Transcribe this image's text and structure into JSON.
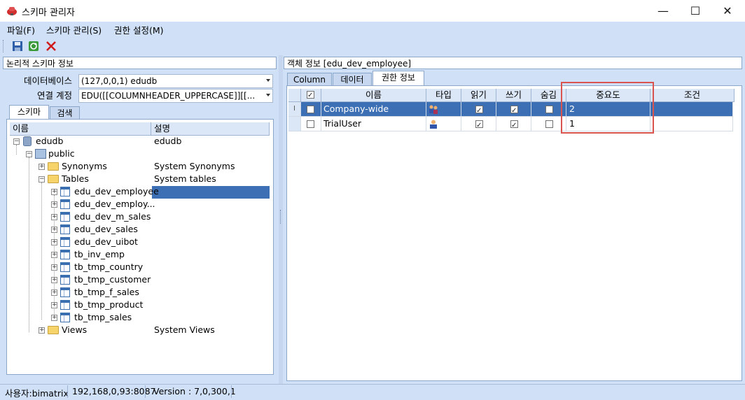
{
  "window": {
    "title": "스키마 관리자",
    "minimize": "—",
    "maximize": "☐",
    "close": "✕"
  },
  "menu": [
    "파일(F)",
    "스키마 관리(S)",
    "권한 설정(M)"
  ],
  "toolbar": {
    "icons": [
      "save-icon",
      "refresh-icon",
      "delete-icon"
    ]
  },
  "left": {
    "header": "논리적 스키마 정보",
    "db_label": "데이터베이스",
    "db_value": "(127,0,0,1) edudb",
    "account_label": "연결 계정",
    "account_value": "EDU([[COLUMNHEADER_UPPERCASE]][[...",
    "tabs": [
      "스키마",
      "검색"
    ],
    "columns": [
      "이름",
      "설명"
    ],
    "tree": [
      {
        "name": "edudb",
        "desc": "edudb"
      },
      {
        "name": "public",
        "desc": ""
      },
      {
        "name": "Synonyms",
        "desc": "System Synonyms"
      },
      {
        "name": "Tables",
        "desc": "System tables"
      },
      {
        "name": "edu_dev_employee",
        "desc": ""
      },
      {
        "name": "edu_dev_employ...",
        "desc": ""
      },
      {
        "name": "edu_dev_m_sales",
        "desc": ""
      },
      {
        "name": "edu_dev_sales",
        "desc": ""
      },
      {
        "name": "edu_dev_uibot",
        "desc": ""
      },
      {
        "name": "tb_inv_emp",
        "desc": ""
      },
      {
        "name": "tb_tmp_country",
        "desc": ""
      },
      {
        "name": "tb_tmp_customer",
        "desc": ""
      },
      {
        "name": "tb_tmp_f_sales",
        "desc": ""
      },
      {
        "name": "tb_tmp_product",
        "desc": ""
      },
      {
        "name": "tb_tmp_sales",
        "desc": ""
      },
      {
        "name": "Views",
        "desc": "System Views"
      }
    ]
  },
  "right": {
    "header": "객체 정보  [edu_dev_employee]",
    "tabs": [
      "Column",
      "데이터",
      "권한 정보"
    ],
    "columns": [
      "이름",
      "타입",
      "읽기",
      "쓰기",
      "숨김",
      "중요도",
      "조건"
    ],
    "rows": [
      {
        "name": "Company-wide",
        "read": true,
        "write": true,
        "hidden": false,
        "importance": "2",
        "condition": ""
      },
      {
        "name": "TrialUser",
        "read": true,
        "write": true,
        "hidden": false,
        "importance": "1",
        "condition": ""
      }
    ],
    "row_marker": "I"
  },
  "status": {
    "user": "사용자:bimatrix",
    "server": "192,168,0,93:8087",
    "version": "Version : 7,0,300,1"
  },
  "colors": {
    "accent": "#3d6fb4",
    "panel": "#cfe0f7",
    "highlight_box": "#d9534f"
  }
}
